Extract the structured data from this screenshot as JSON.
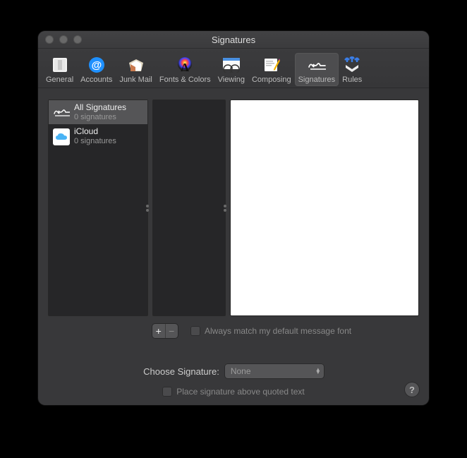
{
  "window": {
    "title": "Signatures"
  },
  "toolbar": {
    "items": [
      {
        "label": "General"
      },
      {
        "label": "Accounts"
      },
      {
        "label": "Junk Mail"
      },
      {
        "label": "Fonts & Colors"
      },
      {
        "label": "Viewing"
      },
      {
        "label": "Composing"
      },
      {
        "label": "Signatures"
      },
      {
        "label": "Rules"
      }
    ]
  },
  "accounts": [
    {
      "name": "All Signatures",
      "sub": "0 signatures"
    },
    {
      "name": "iCloud",
      "sub": "0 signatures"
    }
  ],
  "buttons": {
    "add": "+",
    "remove": "−"
  },
  "options": {
    "match_font": "Always match my default message font",
    "choose_label": "Choose Signature:",
    "choose_value": "None",
    "place_above": "Place signature above quoted text"
  },
  "help": "?"
}
